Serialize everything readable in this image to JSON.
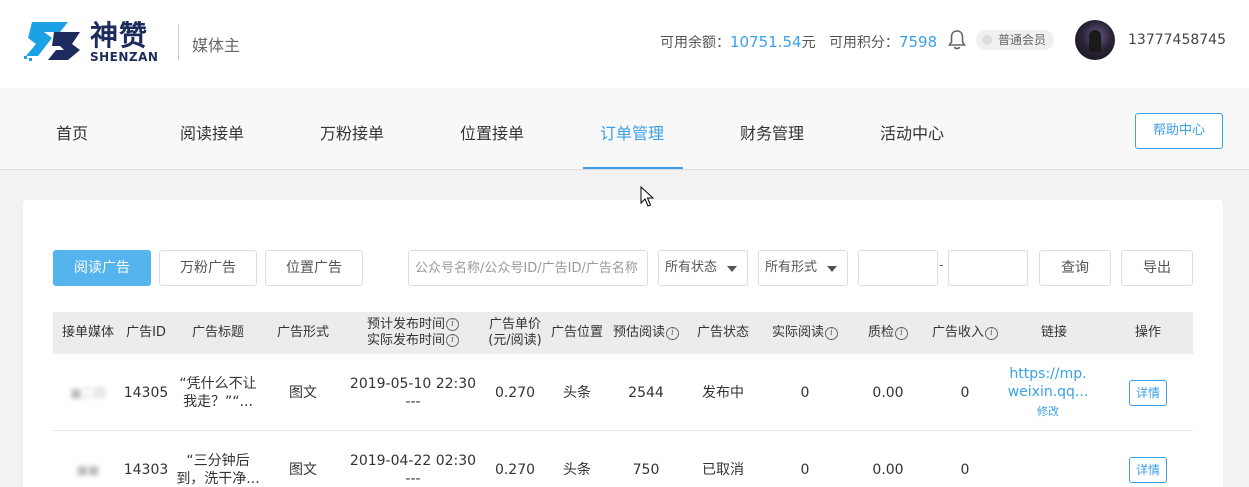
{
  "header": {
    "brand_cn": "神赞",
    "brand_en": "SHENZAN",
    "role": "媒体主",
    "balance_label": "可用余额：",
    "balance_value": "10751.54",
    "balance_unit": "元",
    "points_label": "可用积分：",
    "points_value": "7598",
    "member_level": "普通会员",
    "phone": "13777458745"
  },
  "nav": {
    "items": [
      "首页",
      "阅读接单",
      "万粉接单",
      "位置接单",
      "订单管理",
      "财务管理",
      "活动中心"
    ],
    "active": "订单管理",
    "help": "帮助中心"
  },
  "toolbar": {
    "tabs": [
      "阅读广告",
      "万粉广告",
      "位置广告"
    ],
    "search_placeholder": "公众号名称/公众号ID/广告ID/广告名称",
    "status_select": "所有状态",
    "form_select": "所有形式",
    "date_sep": "-",
    "query": "查询",
    "export": "导出"
  },
  "table": {
    "headers": {
      "media": "接单媒体",
      "ad_id": "广告ID",
      "ad_title": "广告标题",
      "ad_form": "广告形式",
      "time_planned": "预计发布时间",
      "time_actual": "实际发布时间",
      "price_1": "广告单价",
      "price_2": "(元/阅读)",
      "position": "广告位置",
      "est_read": "预估阅读",
      "status": "广告状态",
      "actual_read": "实际阅读",
      "qc": "质检",
      "income": "广告收入",
      "link": "链接",
      "op": "操作"
    },
    "rows": [
      {
        "media": "■二四",
        "ad_id": "14305",
        "title_1": "“凭什么不让",
        "title_2": "我走？”“...",
        "form": "图文",
        "time_planned": "2019-05-10 22:30",
        "time_actual": "---",
        "price": "0.270",
        "position": "头条",
        "est_read": "2544",
        "status": "发布中",
        "actual_read": "0",
        "qc": "0.00",
        "income": "0",
        "link_1": "https://mp.",
        "link_2": "weixin.qq...",
        "link_edit": "修改",
        "detail": "详情"
      },
      {
        "media": "■■",
        "ad_id": "14303",
        "title_1": "“三分钟后",
        "title_2": "到，洗干净...",
        "form": "图文",
        "time_planned": "2019-04-22 02:30",
        "time_actual": "---",
        "price": "0.270",
        "position": "头条",
        "est_read": "750",
        "status": "已取消",
        "actual_read": "0",
        "qc": "0.00",
        "income": "0",
        "link_1": "",
        "link_2": "",
        "link_edit": "",
        "detail": "详情"
      }
    ]
  },
  "colors": {
    "accent": "#3aa0e8",
    "brand_dark": "#1d2b5e",
    "active_tab": "#55b4ee"
  }
}
